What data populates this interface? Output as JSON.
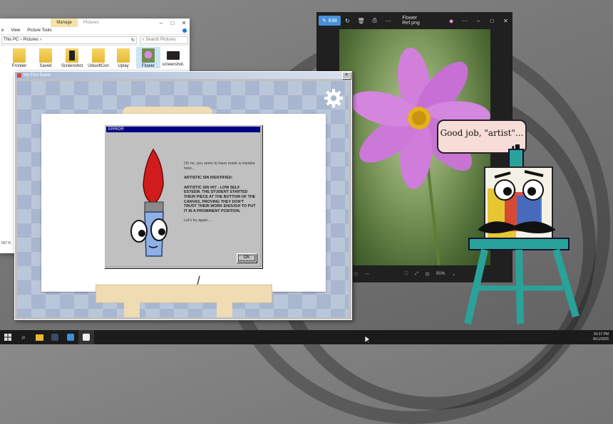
{
  "explorer": {
    "manage_tab": "Manage",
    "window_title": "Pictures",
    "ribbon": [
      "e",
      "View",
      "Picture Tools"
    ],
    "path": [
      "This PC",
      "Pictures"
    ],
    "search_placeholder": "Search Pictures",
    "files": [
      {
        "label": "Frontier",
        "kind": "folder"
      },
      {
        "label": "Saved",
        "kind": "folder"
      },
      {
        "label": "Screenshot",
        "kind": "folder-dark"
      },
      {
        "label": "UbisoftCon",
        "kind": "folder"
      },
      {
        "label": "Uplay",
        "kind": "folder"
      },
      {
        "label": "Flower",
        "kind": "image-flower"
      },
      {
        "label": "screenshot.",
        "kind": "image-dark"
      }
    ],
    "status": "667 K"
  },
  "photos": {
    "edit_label": "Edit",
    "file_name": "Flower Ref.png",
    "zoom": "91%"
  },
  "easel": {
    "window_title": "My First Easel"
  },
  "error_dialog": {
    "title": "ERROR",
    "line1": "Oh no, you seem to have made a mistake here...",
    "heading": "ARTISTIC SIN IDENTIFIED:",
    "body": "ARTISTIC SIN #07 - LOW SELF ESTEEM. THE STUDENT STARTED THEIR PIECE AT THE BOTTOM OF THE CANVAS, PROVING THEY DON'T TRUST THEIR WORK ENOUGH TO PUT IT IN A PROMINENT POSITION.",
    "footer": "Let's try again...",
    "ok_label": "OK"
  },
  "critic": {
    "speech": "Good job, \"artist\"..."
  },
  "taskbar": {
    "time": "10:37 PM",
    "date": "8/11/2025"
  }
}
